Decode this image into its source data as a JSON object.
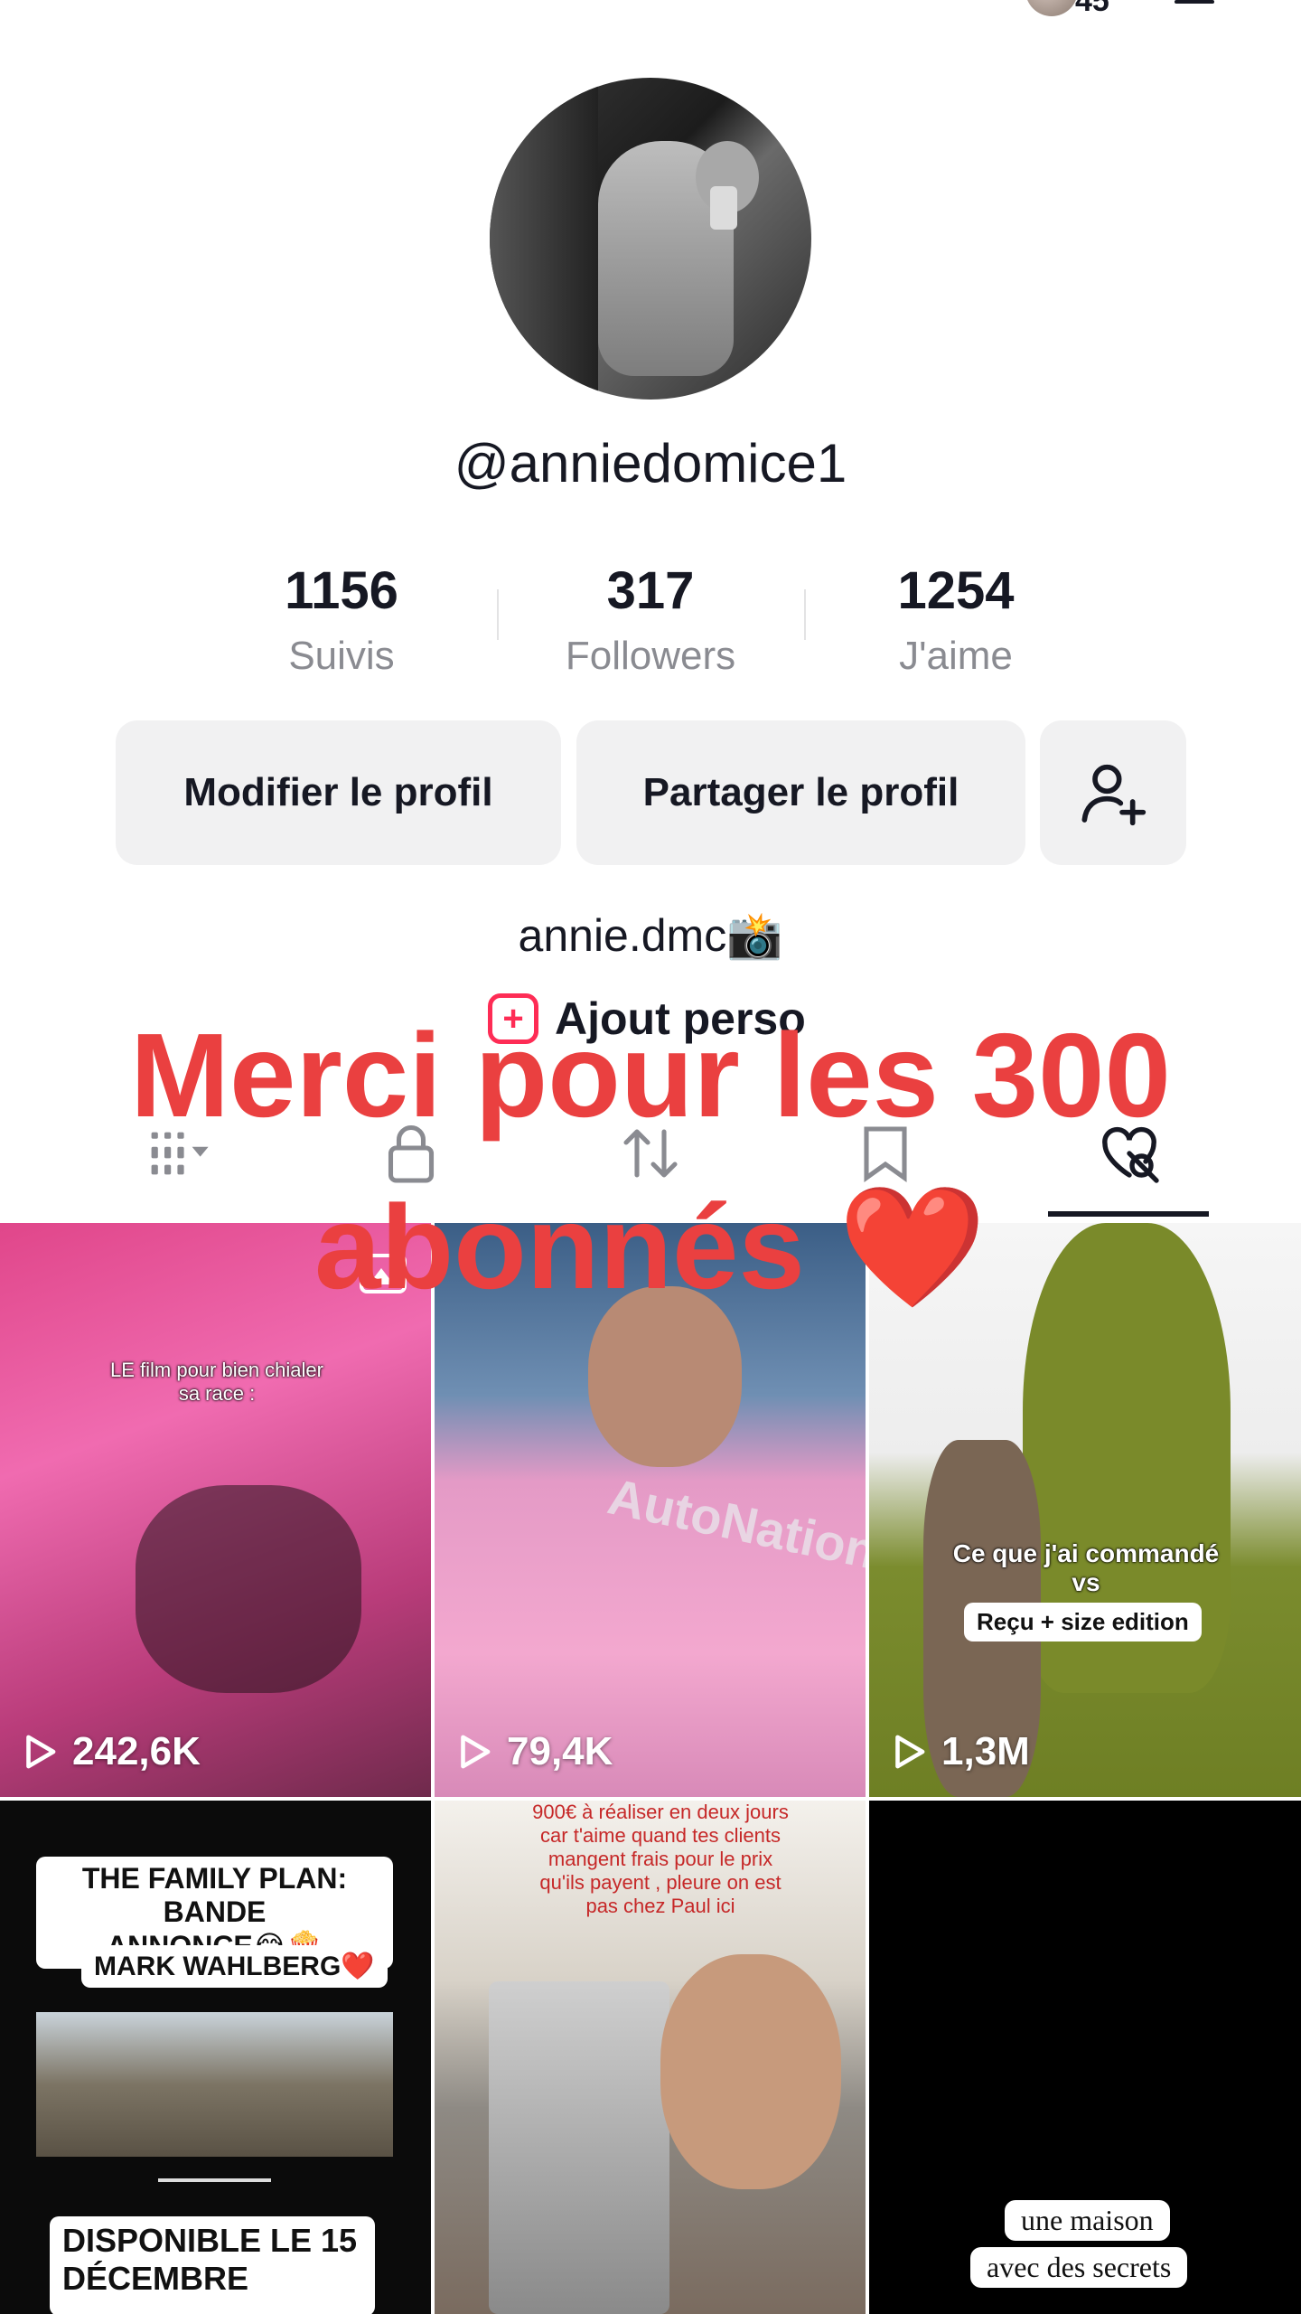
{
  "header": {
    "partial_count": "45"
  },
  "profile": {
    "username": "@anniedomice1",
    "stats": [
      {
        "value": "1156",
        "label": "Suivis"
      },
      {
        "value": "317",
        "label": "Followers"
      },
      {
        "value": "1254",
        "label": "J'aime"
      }
    ],
    "buttons": {
      "edit": "Modifier le profil",
      "share": "Partager le profil"
    },
    "bio": "annie.dmc📸",
    "add_link": "Ajout perso"
  },
  "overlay_text": {
    "line1": "Merci pour les 300",
    "line2": "abonnés ❤️"
  },
  "tabs": [
    {
      "icon": "grid-icon"
    },
    {
      "icon": "lock-icon"
    },
    {
      "icon": "repost-icon"
    },
    {
      "icon": "bookmark-icon"
    },
    {
      "icon": "liked-hidden-icon",
      "active": true
    }
  ],
  "videos": [
    {
      "caption": "LE film pour bien chialer\nsa race :",
      "views": "242,6K"
    },
    {
      "caption": "AutoNation",
      "views": "79,4K"
    },
    {
      "caption": "Ce que j'ai commandé\nvs",
      "sub_label": "Reçu + size edition",
      "views": "1,3M"
    },
    {
      "lines": [
        "THE FAMILY PLAN: BANDE\nANNONCE😂🍿",
        "MARK WAHLBERG❤️"
      ],
      "bottom": "DISPONIBLE LE 15\nDÉCEMBRE"
    },
    {
      "caption": "900€ à réaliser en deux jours\ncar t'aime quand tes clients\nmangent frais pour le prix\nqu'ils payent , pleure on est\npas chez Paul ici"
    },
    {
      "lines": [
        "une maison",
        "avec des secrets"
      ]
    }
  ],
  "colors": {
    "accent": "#fe2c55",
    "overlay_red": "#ea4040",
    "button_bg": "#f1f1f2",
    "muted_text": "#8a8b91"
  }
}
